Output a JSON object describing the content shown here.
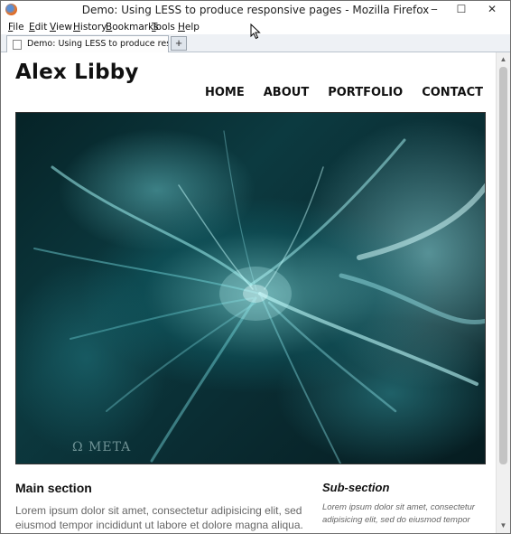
{
  "window": {
    "title": "Demo: Using LESS to produce responsive pages - Mozilla Firefox",
    "minimize_glyph": "‒",
    "maximize_glyph": "☐",
    "close_glyph": "✕"
  },
  "menubar": {
    "items": [
      {
        "label": "File",
        "accel": "F",
        "rest": "ile"
      },
      {
        "label": "Edit",
        "accel": "E",
        "rest": "dit"
      },
      {
        "label": "View",
        "accel": "V",
        "rest": "iew"
      },
      {
        "label": "History",
        "accel": "H",
        "rest": "istory"
      },
      {
        "label": "Bookmarks",
        "accel": "B",
        "rest": "ookmarks"
      },
      {
        "label": "Tools",
        "accel": "T",
        "rest": "ools"
      },
      {
        "label": "Help",
        "accel": "H",
        "rest": "elp"
      }
    ]
  },
  "tabs": {
    "active_label": "Demo: Using LESS to produce responsiv...",
    "new_tab_glyph": "+"
  },
  "page": {
    "site_title": "Alex Libby",
    "nav": [
      "HOME",
      "ABOUT",
      "PORTFOLIO",
      "CONTACT"
    ],
    "hero_watermark": "Ω META",
    "main_heading": "Main section",
    "main_text": [
      "Lorem ipsum dolor sit amet, consectetur adipisicing elit, sed do",
      "eiusmod tempor incididunt ut labore et dolore magna aliqua. Ut"
    ],
    "sub_heading": "Sub-section",
    "sub_text": [
      "Lorem ipsum dolor sit amet, consectetur",
      "adipisicing elit, sed do eiusmod tempor"
    ]
  },
  "colors": {
    "hero_dark": "#062327",
    "hero_cyan": "#8ef0f0",
    "text_muted": "#666666"
  }
}
